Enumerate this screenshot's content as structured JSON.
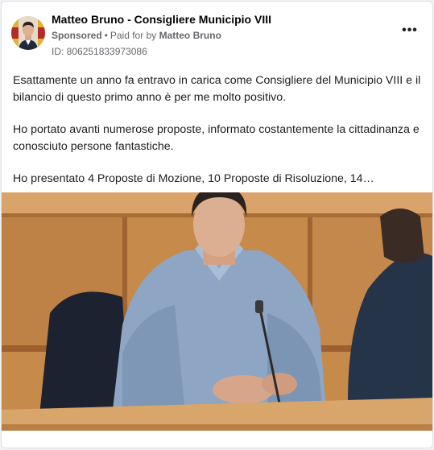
{
  "ad": {
    "page_name": "Matteo Bruno - Consigliere Municipio VIII",
    "sponsored_label": "Sponsored",
    "separator": "•",
    "paid_for_prefix": "Paid for by",
    "paid_for_name": "Matteo Bruno",
    "ad_id": "ID: 806251833973086",
    "more_icon": "more-horizontal-icon",
    "body_paragraphs": [
      "Esattamente un anno fa entravo in carica come Consigliere del Municipio VIII e il bilancio di questo primo anno è per me molto positivo.",
      "Ho portato avanti numerose proposte, informato costantemente la cittadinanza e conosciuto persone fantastiche.",
      "Ho presentato 4 Proposte di Mozione, 10 Proposte di Risoluzione, 14…"
    ]
  },
  "colors": {
    "background": "#f0f2f5",
    "card": "#ffffff",
    "secondary_text": "#65676b",
    "wood": "#c68a4a"
  }
}
